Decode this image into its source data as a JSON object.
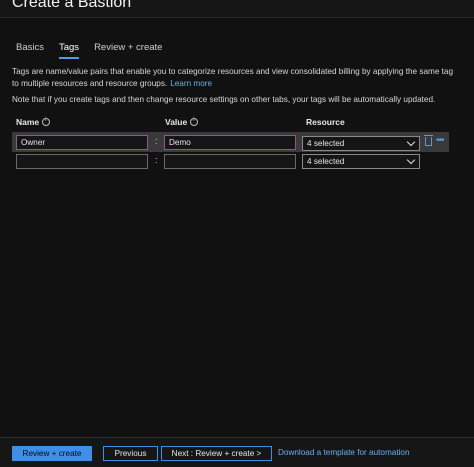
{
  "header": {
    "title": "Create a Bastion"
  },
  "tabs": [
    {
      "label": "Basics",
      "active": false
    },
    {
      "label": "Tags",
      "active": true
    },
    {
      "label": "Review + create",
      "active": false
    }
  ],
  "description": {
    "line1": "Tags are name/value pairs that enable you to categorize resources and view consolidated billing by applying the same tag",
    "line2": "to multiple resources and resource groups.",
    "learn_more": "Learn more",
    "note": "Note that if you create tags and then change resource settings on other tabs, your tags will be automatically updated."
  },
  "columns": {
    "name": "Name",
    "value": "Value",
    "resource": "Resource"
  },
  "rows": [
    {
      "name": "Owner",
      "separator": ":",
      "value": "Demo",
      "resource": "4 selected"
    },
    {
      "name": "",
      "separator": ":",
      "value": "",
      "resource": "4 selected"
    }
  ],
  "row_actions": {
    "delete_icon": "trash-icon",
    "more_icon": "more-icon"
  },
  "footer": {
    "review_create": "Review + create",
    "previous": "Previous",
    "next": "Next : Review + create >",
    "download_template": "Download a template for automation"
  },
  "colors": {
    "accent": "#3f8fe8",
    "background": "#111111",
    "row_highlight": "#3a3a3a"
  }
}
